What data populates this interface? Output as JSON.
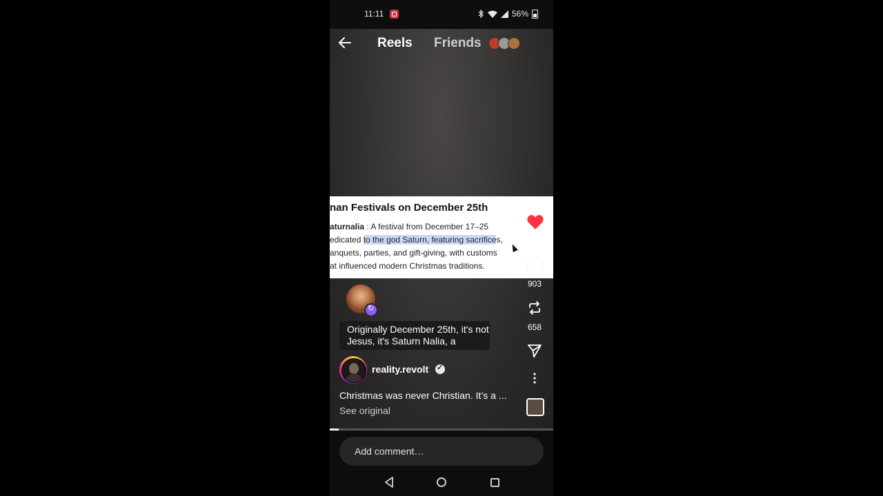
{
  "status_bar": {
    "time": "11:11",
    "battery": "56%"
  },
  "top_nav": {
    "tab_reels": "Reels",
    "tab_friends": "Friends"
  },
  "doc": {
    "title": "nan Festivals on December 25th",
    "lines": [
      {
        "bold": "aturnalia",
        "text": " : A festival from December 17–25"
      },
      {
        "pre": "edicated ",
        "highlight": "to the god Saturn, featuring sacrifice",
        "post": "s,"
      },
      {
        "text": "anquets, parties, and gift-giving, with customs"
      },
      {
        "text": "at influenced modern Christmas traditions."
      }
    ]
  },
  "actions": {
    "comments_count": "903",
    "reposts_count": "658"
  },
  "caption": "Originally December 25th, it's not Jesus, it's Saturn Nalia, a",
  "user": {
    "username": "reality.revolt"
  },
  "description": "Christmas was never Christian. It’s a ...",
  "see_original": "See original",
  "progress": 0.04,
  "comment": {
    "placeholder": "Add comment…"
  },
  "colors": {
    "like": "#ff3040",
    "highlight": "#c9daf8",
    "background": "#000000"
  }
}
